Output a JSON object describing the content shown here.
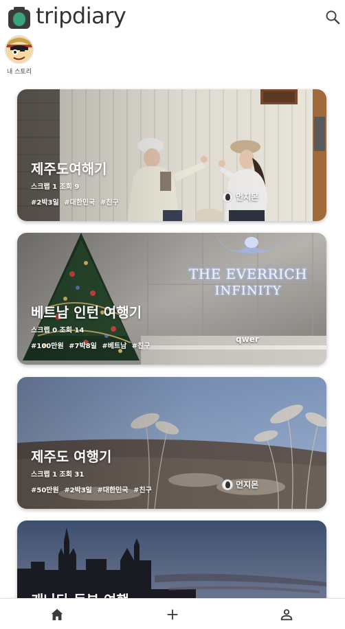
{
  "app": {
    "name": "tripdiary"
  },
  "header": {
    "logo_icon": "camera-icon",
    "search_icon": "search-icon"
  },
  "story": {
    "label": "내 스토리"
  },
  "cards": [
    {
      "title": "제주도여해기",
      "meta": "스크랩 1 조회 9",
      "tags": [
        "#2박3일",
        "#대한민국",
        "#친구"
      ],
      "author": "먼지몬"
    },
    {
      "title": "베트남 인턴 여행기",
      "meta": "스크랩 0 조회 14",
      "tags": [
        "#100만원",
        "#7박8일",
        "#베트남",
        "#친구"
      ],
      "author": "qwer",
      "sign_line1": "THE EVERRICH",
      "sign_line2": "INFINITY"
    },
    {
      "title": "제주도 여행기",
      "meta": "스크랩 1 조회 31",
      "tags": [
        "#50만원",
        "#2박3일",
        "#대한민국",
        "#친구"
      ],
      "author": "먼지몬"
    },
    {
      "title": "캐나다 동부 여행"
    }
  ],
  "bottom_nav": {
    "items": [
      "home-icon",
      "plus-icon",
      "profile-icon"
    ]
  },
  "colors": {
    "logo_green": "#3aa57c",
    "logo_dark": "#3b3b3b"
  }
}
